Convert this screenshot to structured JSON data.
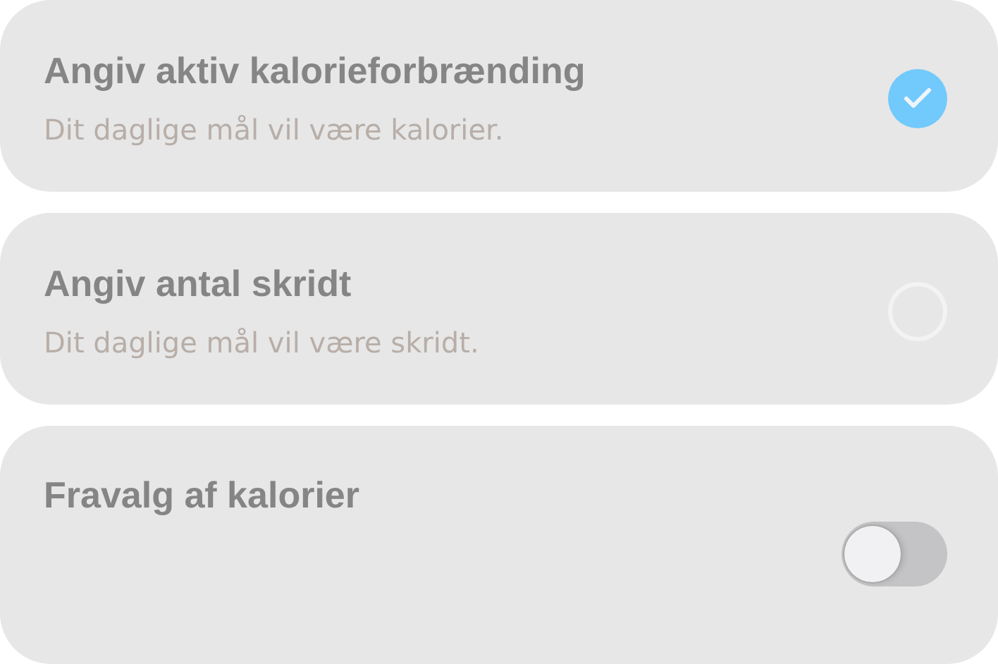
{
  "options": [
    {
      "kind": "radio",
      "title": "Angiv aktiv kalorieforbrænding",
      "subtitle": "Dit daglige mål vil være kalorier.",
      "selected": true
    },
    {
      "kind": "radio",
      "title": "Angiv antal skridt",
      "subtitle": "Dit daglige mål vil være skridt.",
      "selected": false
    },
    {
      "kind": "toggle",
      "title": "Fravalg af kalorier",
      "on": false
    }
  ]
}
